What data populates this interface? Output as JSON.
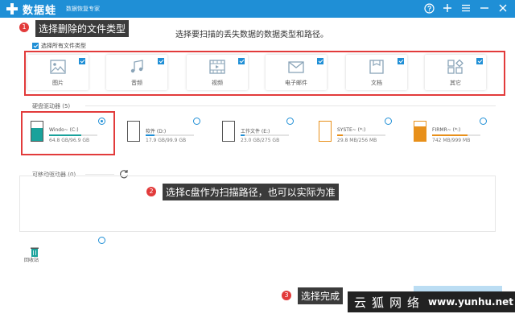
{
  "titlebar": {
    "app_name": "数据蛙",
    "app_subtitle": "数据恢复专家",
    "icons": [
      "help-icon",
      "add-icon",
      "menu-icon",
      "minimize-icon",
      "close-icon"
    ]
  },
  "instruction": "选择要扫描的丢失数据的数据类型和路径。",
  "select_all_label": "选择所有文件类型",
  "file_types": [
    {
      "label": "图片",
      "icon": "image-icon",
      "checked": true
    },
    {
      "label": "音频",
      "icon": "audio-icon",
      "checked": true
    },
    {
      "label": "视频",
      "icon": "video-icon",
      "checked": true
    },
    {
      "label": "电子邮件",
      "icon": "email-icon",
      "checked": true
    },
    {
      "label": "文档",
      "icon": "document-icon",
      "checked": true
    },
    {
      "label": "其它",
      "icon": "other-icon",
      "checked": true
    }
  ],
  "hard_drives_label": "硬盘驱动器 (5)",
  "drives": [
    {
      "name": "Windo~ (C:)",
      "size": "64.8 GB/96.9 GB",
      "used": 0.67,
      "selected": true,
      "color": "#1aa29b"
    },
    {
      "name": "软件 (D:)",
      "size": "17.9 GB/99.9 GB",
      "used": 0.18,
      "selected": false,
      "color": "#1f8fd6"
    },
    {
      "name": "工作文件 (E:)",
      "size": "23.0 GB/275 GB",
      "used": 0.08,
      "selected": false,
      "color": "#1f8fd6"
    },
    {
      "name": "SYSTE~ (*:)",
      "size": "29.8 MB/256 MB",
      "used": 0.12,
      "selected": false,
      "color": "#e8901a"
    },
    {
      "name": "FIRMR~ (*:)",
      "size": "742 MB/999 MB",
      "used": 0.74,
      "selected": false,
      "color": "#e8901a"
    }
  ],
  "removable_label": "可移动驱动器 (0)",
  "recycle_label": "回收站",
  "annotations": [
    {
      "num": "1",
      "text": "选择删除的文件类型"
    },
    {
      "num": "2",
      "text": "选择c盘作为扫描路径，也可以实际为准"
    },
    {
      "num": "3",
      "text": "选择完成"
    }
  ],
  "watermark": {
    "cn": "云狐网络",
    "url": "www.yunhu.net"
  },
  "colors": {
    "primary": "#1f8fd6",
    "highlight": "#e23b3b"
  }
}
